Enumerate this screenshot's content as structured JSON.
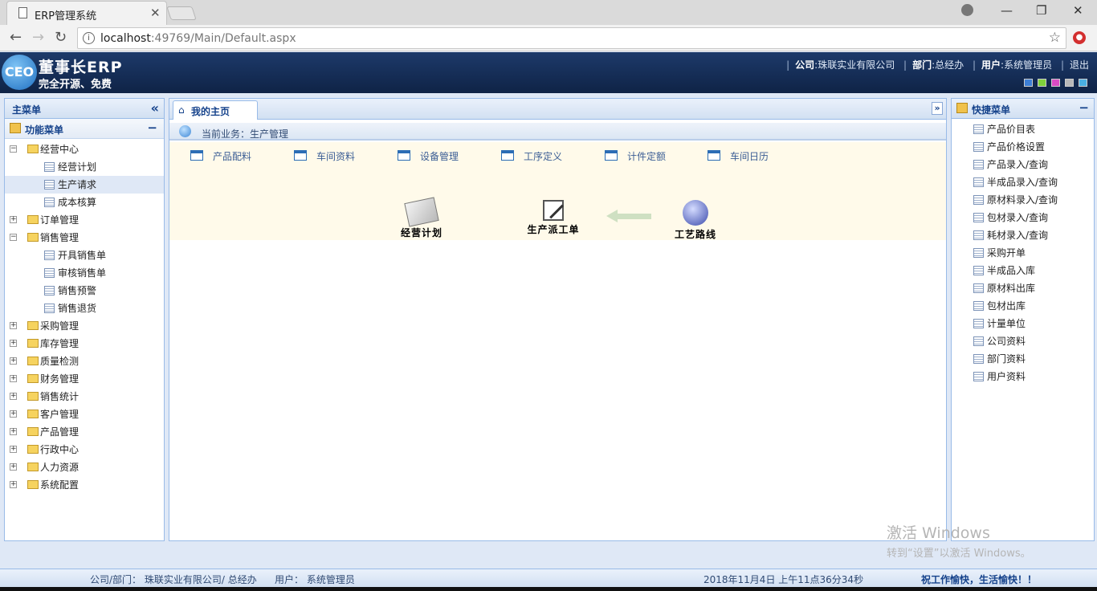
{
  "browser": {
    "tab_title": "ERP管理系统",
    "url_host": "localhost",
    "url_path": ":49769/Main/Default.aspx"
  },
  "header": {
    "logo_badge": "CEO",
    "logo_title": "董事长ERP",
    "logo_sub": "完全开源、免费",
    "company_label": "公司",
    "company_value": "珠联实业有限公司",
    "dept_label": "部门",
    "dept_value": "总经办",
    "user_label": "用户",
    "user_value": "系统管理员",
    "logout": "退出",
    "theme_colors": [
      "#3d7fd6",
      "#7fd13b",
      "#d94bc4",
      "#b8b8b8",
      "#4ab0e3"
    ]
  },
  "left_panel": {
    "title": "主菜单",
    "section_title": "功能菜单",
    "tree": [
      {
        "label": "经营中心",
        "expanded": true
      },
      {
        "label": "经营计划"
      },
      {
        "label": "生产请求",
        "selected": true
      },
      {
        "label": "成本核算"
      },
      {
        "label": "订单管理",
        "expanded": false
      },
      {
        "label": "销售管理",
        "expanded": true
      },
      {
        "label": "开具销售单"
      },
      {
        "label": "审核销售单"
      },
      {
        "label": "销售预警"
      },
      {
        "label": "销售退货"
      },
      {
        "label": "采购管理",
        "expanded": false
      },
      {
        "label": "库存管理",
        "expanded": false
      },
      {
        "label": "质量检测",
        "expanded": false
      },
      {
        "label": "财务管理",
        "expanded": false
      },
      {
        "label": "销售统计",
        "expanded": false
      },
      {
        "label": "客户管理",
        "expanded": false
      },
      {
        "label": "产品管理",
        "expanded": false
      },
      {
        "label": "行政中心",
        "expanded": false
      },
      {
        "label": "人力资源",
        "expanded": false
      },
      {
        "label": "系统配置",
        "expanded": false
      }
    ]
  },
  "center_panel": {
    "tab_label": "我的主页",
    "business_text": "当前业务：生产管理",
    "modules": [
      "产品配料",
      "车间资料",
      "设备管理",
      "工序定义",
      "计件定额",
      "车间日历"
    ],
    "flow": [
      "经营计划",
      "生产派工单",
      "工艺路线"
    ]
  },
  "right_panel": {
    "title": "快捷菜单",
    "items": [
      "产品价目表",
      "产品价格设置",
      "产品录入/查询",
      "半成品录入/查询",
      "原材料录入/查询",
      "包材录入/查询",
      "耗材录入/查询",
      "采购开单",
      "半成品入库",
      "原材料出库",
      "包材出库",
      "计量单位",
      "公司资料",
      "部门资料",
      "用户资料"
    ]
  },
  "watermark": {
    "title": "激活 Windows",
    "sub": "转到“设置”以激活 Windows。"
  },
  "status_bar": {
    "company_dept": "公司/部门：  珠联实业有限公司/ 总经办",
    "user": "用户：  系统管理员",
    "datetime": "2018年11月4日  上午11点36分34秒",
    "slogan": "祝工作愉快，生活愉快！！"
  }
}
